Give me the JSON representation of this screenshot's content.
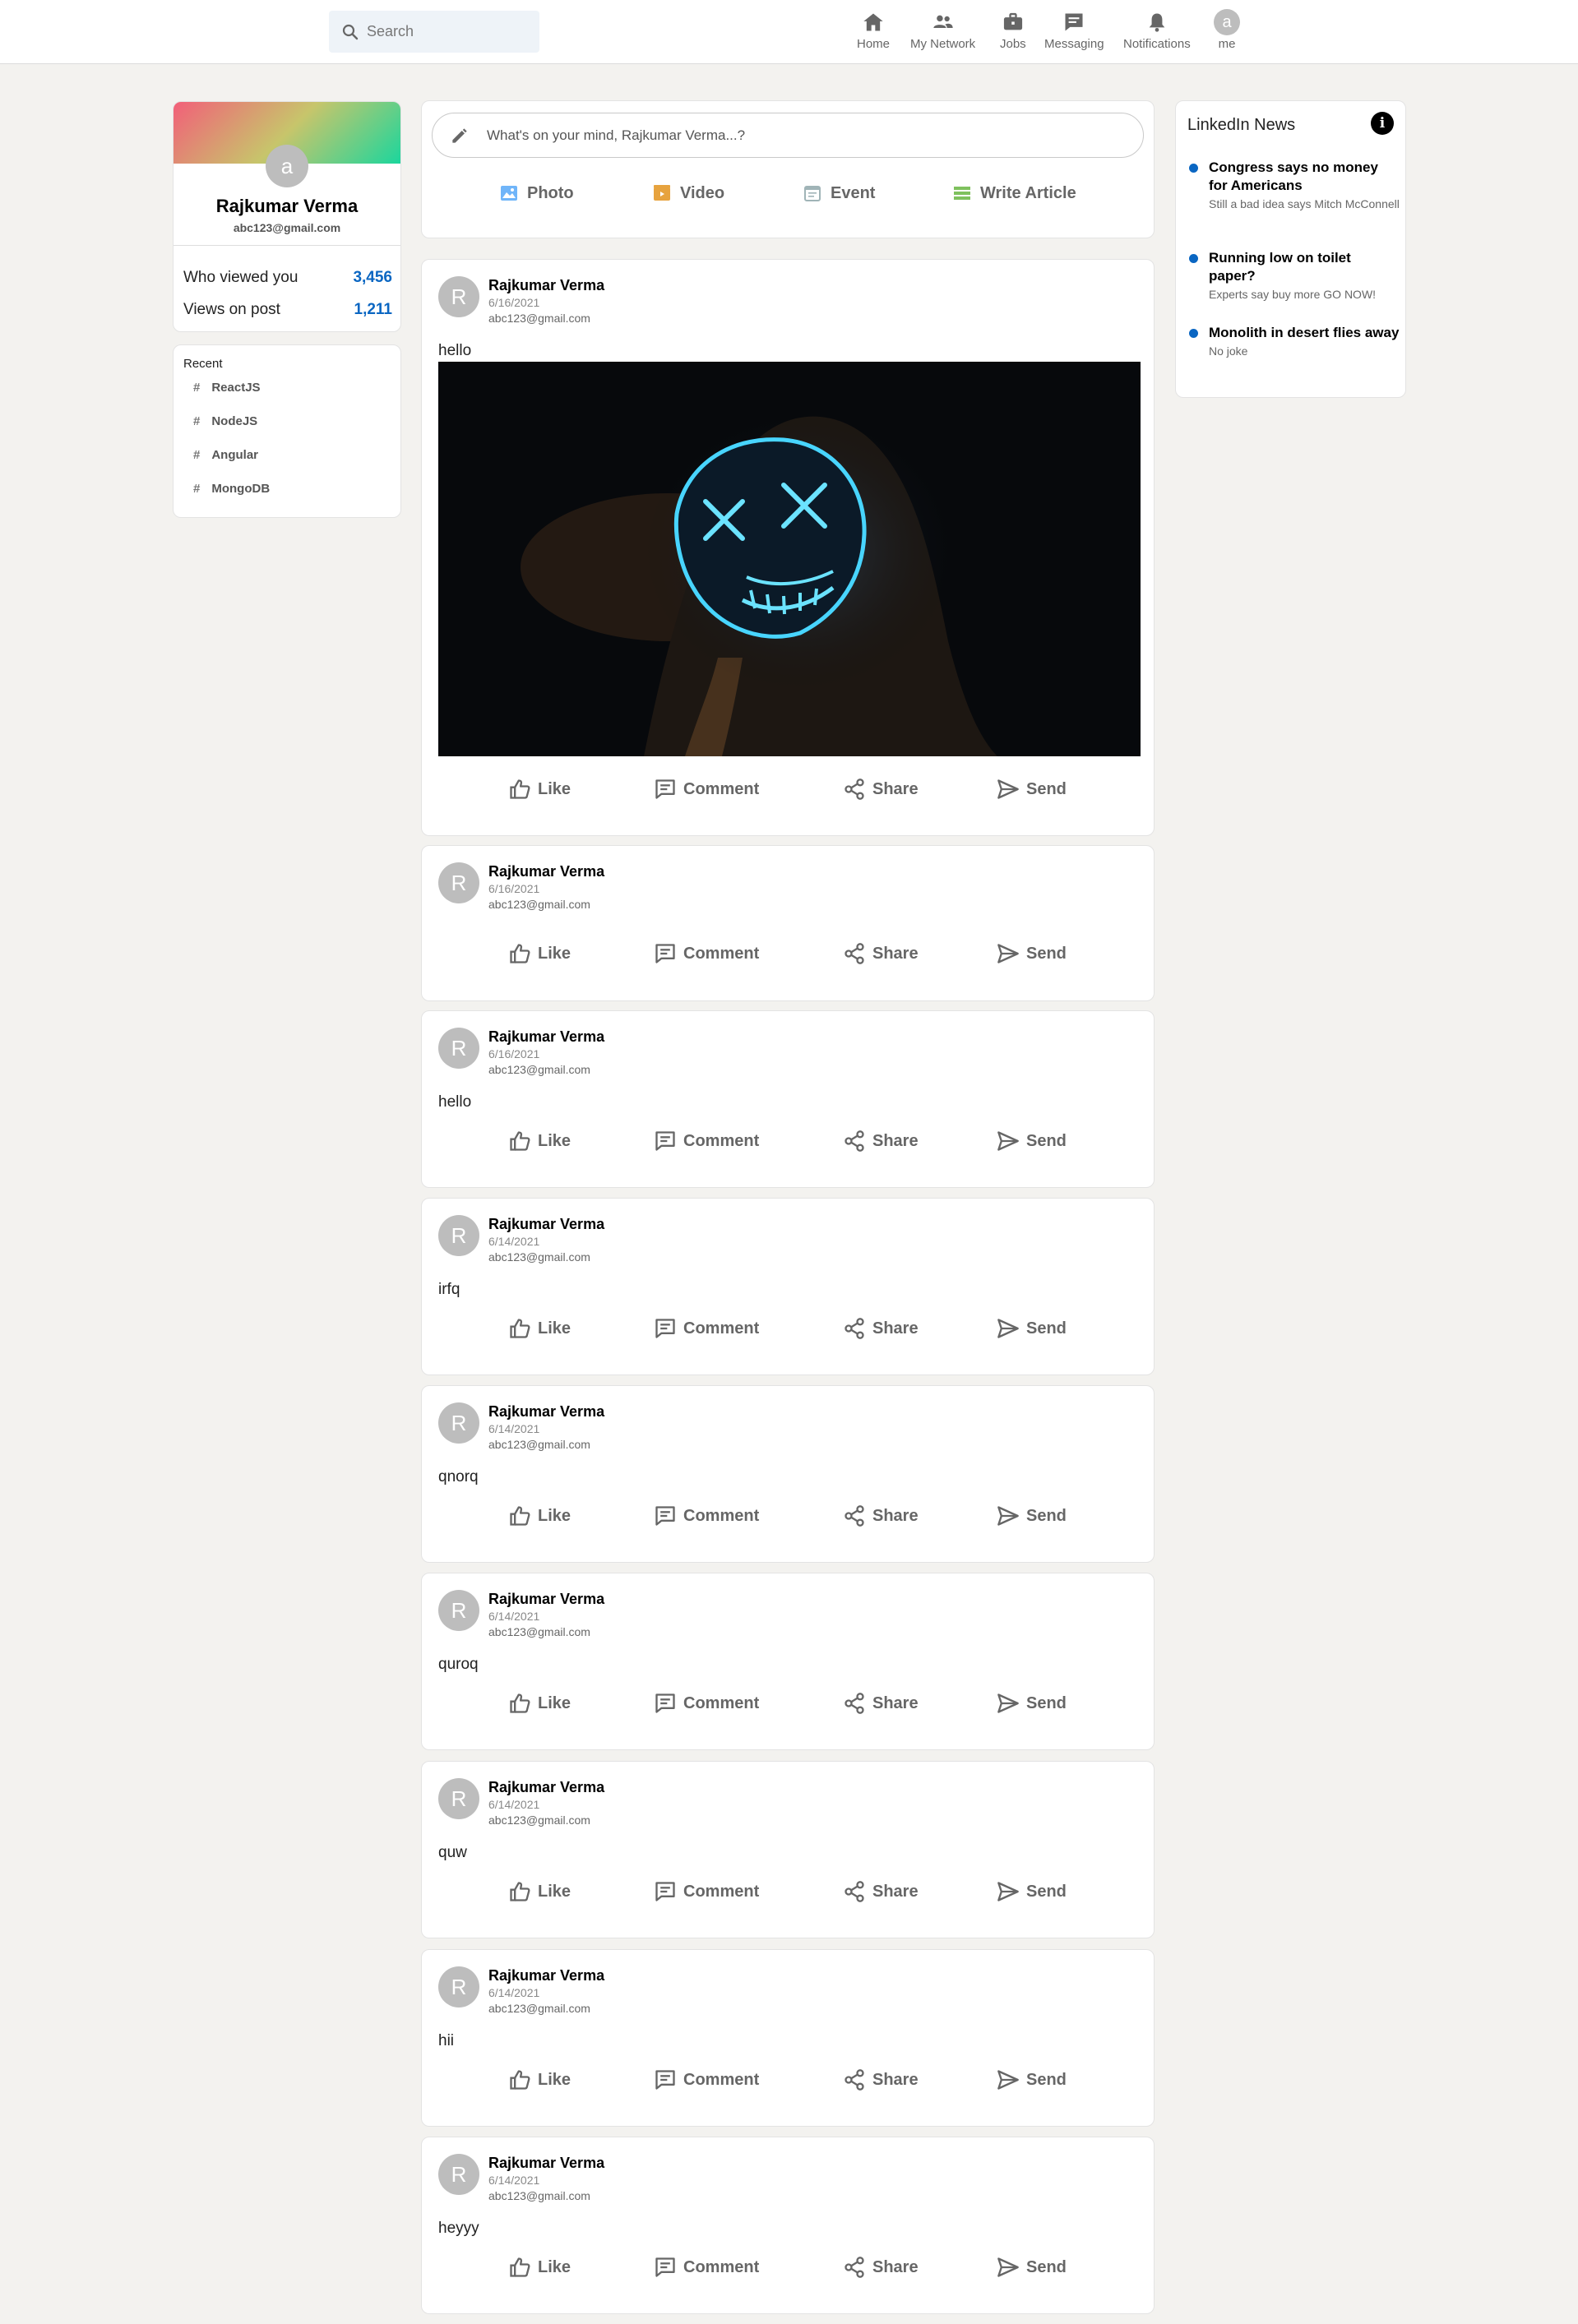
{
  "header": {
    "search_placeholder": "Search",
    "nav": [
      {
        "label": "Home",
        "icon": "home-icon"
      },
      {
        "label": "My Network",
        "icon": "network-icon"
      },
      {
        "label": "Jobs",
        "icon": "briefcase-icon"
      },
      {
        "label": "Messaging",
        "icon": "message-icon"
      },
      {
        "label": "Notifications",
        "icon": "bell-icon"
      },
      {
        "label": "me",
        "icon": "avatar",
        "avatar_letter": "a"
      }
    ]
  },
  "profile": {
    "avatar_letter": "a",
    "name": "Rajkumar Verma",
    "email": "abc123@gmail.com",
    "stats": [
      {
        "label": "Who viewed you",
        "value": "3,456"
      },
      {
        "label": "Views on post",
        "value": "1,211"
      }
    ]
  },
  "recent": {
    "title": "Recent",
    "tags": [
      "ReactJS",
      "NodeJS",
      "Angular",
      "MongoDB"
    ]
  },
  "share": {
    "placeholder": "What's on your mind, Rajkumar Verma...?",
    "buttons": [
      {
        "label": "Photo",
        "color": "#70b5f9"
      },
      {
        "label": "Video",
        "color": "#e7a33e"
      },
      {
        "label": "Event",
        "color": "#a0b4b7"
      },
      {
        "label": "Write Article",
        "color": "#7fc15e"
      }
    ]
  },
  "actions": {
    "like": "Like",
    "comment": "Comment",
    "share": "Share",
    "send": "Send"
  },
  "posts": [
    {
      "avatar_letter": "R",
      "name": "Rajkumar Verma",
      "date": "6/16/2021",
      "email": "abc123@gmail.com",
      "text": "hello",
      "has_image": true
    },
    {
      "avatar_letter": "R",
      "name": "Rajkumar Verma",
      "date": "6/16/2021",
      "email": "abc123@gmail.com",
      "text": "",
      "has_image": false
    },
    {
      "avatar_letter": "R",
      "name": "Rajkumar Verma",
      "date": "6/16/2021",
      "email": "abc123@gmail.com",
      "text": "hello",
      "has_image": false
    },
    {
      "avatar_letter": "R",
      "name": "Rajkumar Verma",
      "date": "6/14/2021",
      "email": "abc123@gmail.com",
      "text": "irfq",
      "has_image": false
    },
    {
      "avatar_letter": "R",
      "name": "Rajkumar Verma",
      "date": "6/14/2021",
      "email": "abc123@gmail.com",
      "text": "qnorq",
      "has_image": false
    },
    {
      "avatar_letter": "R",
      "name": "Rajkumar Verma",
      "date": "6/14/2021",
      "email": "abc123@gmail.com",
      "text": "quroq",
      "has_image": false
    },
    {
      "avatar_letter": "R",
      "name": "Rajkumar Verma",
      "date": "6/14/2021",
      "email": "abc123@gmail.com",
      "text": "quw",
      "has_image": false
    },
    {
      "avatar_letter": "R",
      "name": "Rajkumar Verma",
      "date": "6/14/2021",
      "email": "abc123@gmail.com",
      "text": "hii",
      "has_image": false
    },
    {
      "avatar_letter": "R",
      "name": "Rajkumar Verma",
      "date": "6/14/2021",
      "email": "abc123@gmail.com",
      "text": "heyyy",
      "has_image": false
    }
  ],
  "news": {
    "title": "LinkedIn News",
    "info_icon": "info-icon",
    "items": [
      {
        "title": "Congress says no money for Americans",
        "subtitle": "Still a bad idea says Mitch McConnell"
      },
      {
        "title": "Running low on toilet paper?",
        "subtitle": "Experts say buy more GO NOW!"
      },
      {
        "title": "Monolith in desert flies away",
        "subtitle": "No joke"
      }
    ],
    "accent": "#0a66c2"
  }
}
